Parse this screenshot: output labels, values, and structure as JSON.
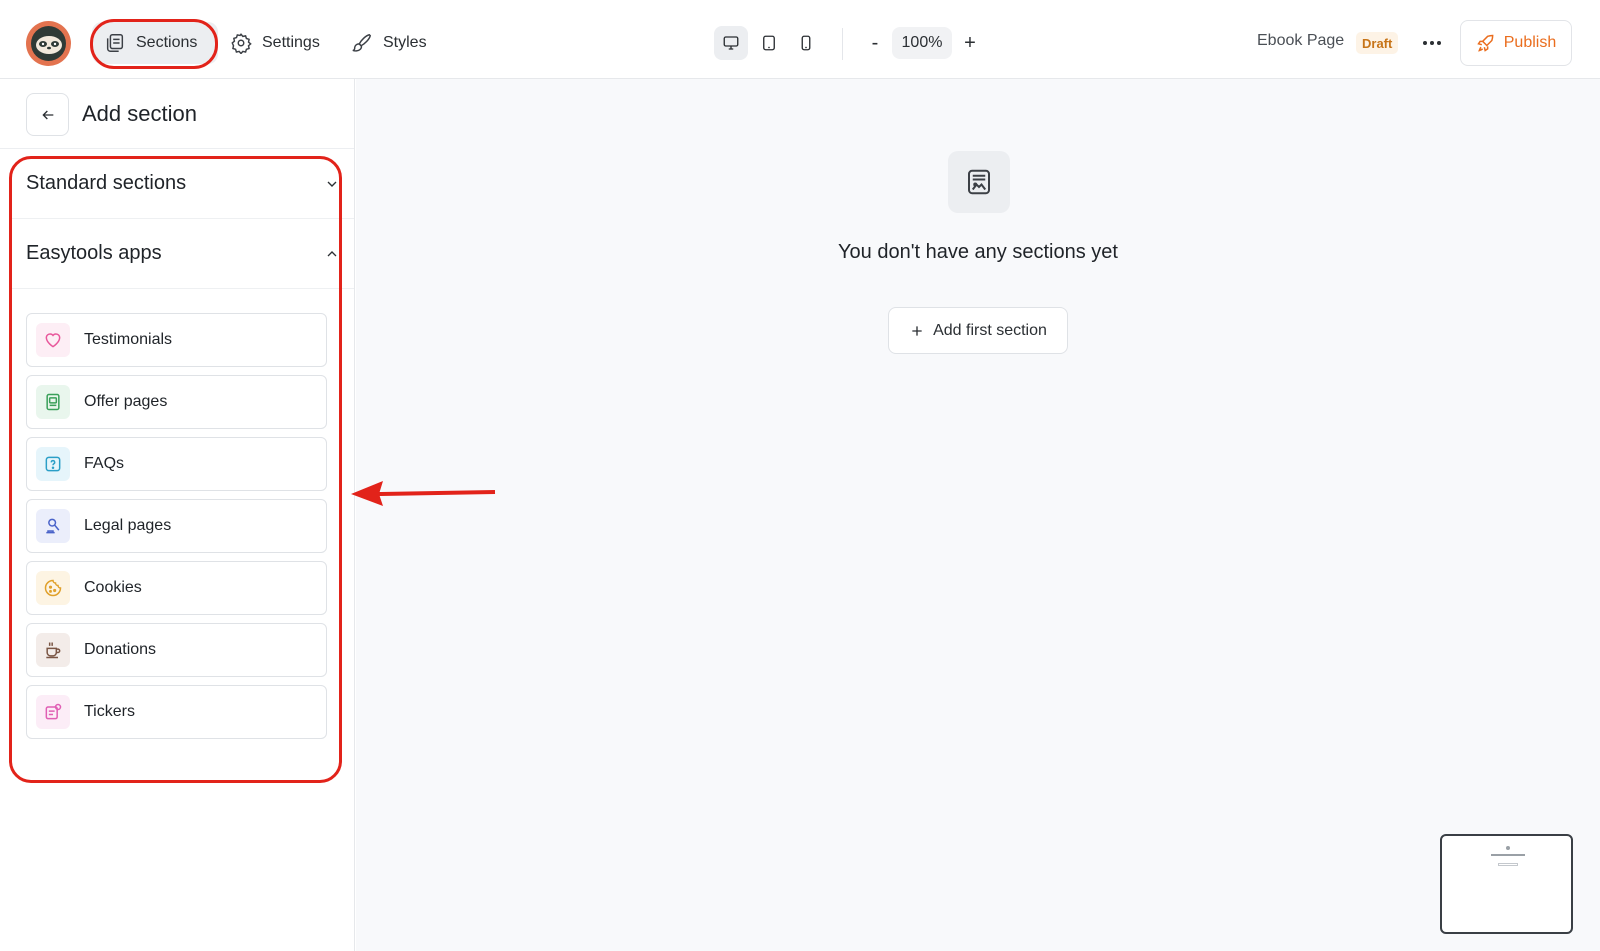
{
  "topbar": {
    "nav": [
      {
        "label": "Sections",
        "icon": "sections-icon"
      },
      {
        "label": "Settings",
        "icon": "gear-icon"
      },
      {
        "label": "Styles",
        "icon": "brush-icon"
      }
    ],
    "zoom": {
      "minus": "-",
      "value": "100%",
      "plus": "+"
    },
    "page_name": "Ebook Page",
    "status": "Draft",
    "publish_label": "Publish"
  },
  "sidebar": {
    "title": "Add section",
    "accordions": [
      {
        "label": "Standard sections",
        "state": "collapsed"
      },
      {
        "label": "Easytools apps",
        "state": "expanded"
      }
    ],
    "apps": [
      {
        "label": "Testimonials",
        "icon": "heart-icon",
        "color": "#e8579b",
        "bg": "#fdeef5"
      },
      {
        "label": "Offer pages",
        "icon": "offer-page-icon",
        "color": "#3aa05a",
        "bg": "#e9f6ed"
      },
      {
        "label": "FAQs",
        "icon": "question-icon",
        "color": "#2b9fc7",
        "bg": "#e6f5fb"
      },
      {
        "label": "Legal pages",
        "icon": "legal-icon",
        "color": "#4a63c9",
        "bg": "#ebeefb"
      },
      {
        "label": "Cookies",
        "icon": "cookie-icon",
        "color": "#e0a02a",
        "bg": "#fdf4e3"
      },
      {
        "label": "Donations",
        "icon": "coffee-cup-icon",
        "color": "#7a5544",
        "bg": "#f3ece9"
      },
      {
        "label": "Tickers",
        "icon": "ticker-icon",
        "color": "#e05fb4",
        "bg": "#fcedf7"
      }
    ]
  },
  "canvas": {
    "empty_text": "You don't have any sections yet",
    "add_first_label": "Add first section"
  },
  "colors": {
    "highlight": "#e2231a",
    "accent_orange": "#ea6d1e"
  }
}
